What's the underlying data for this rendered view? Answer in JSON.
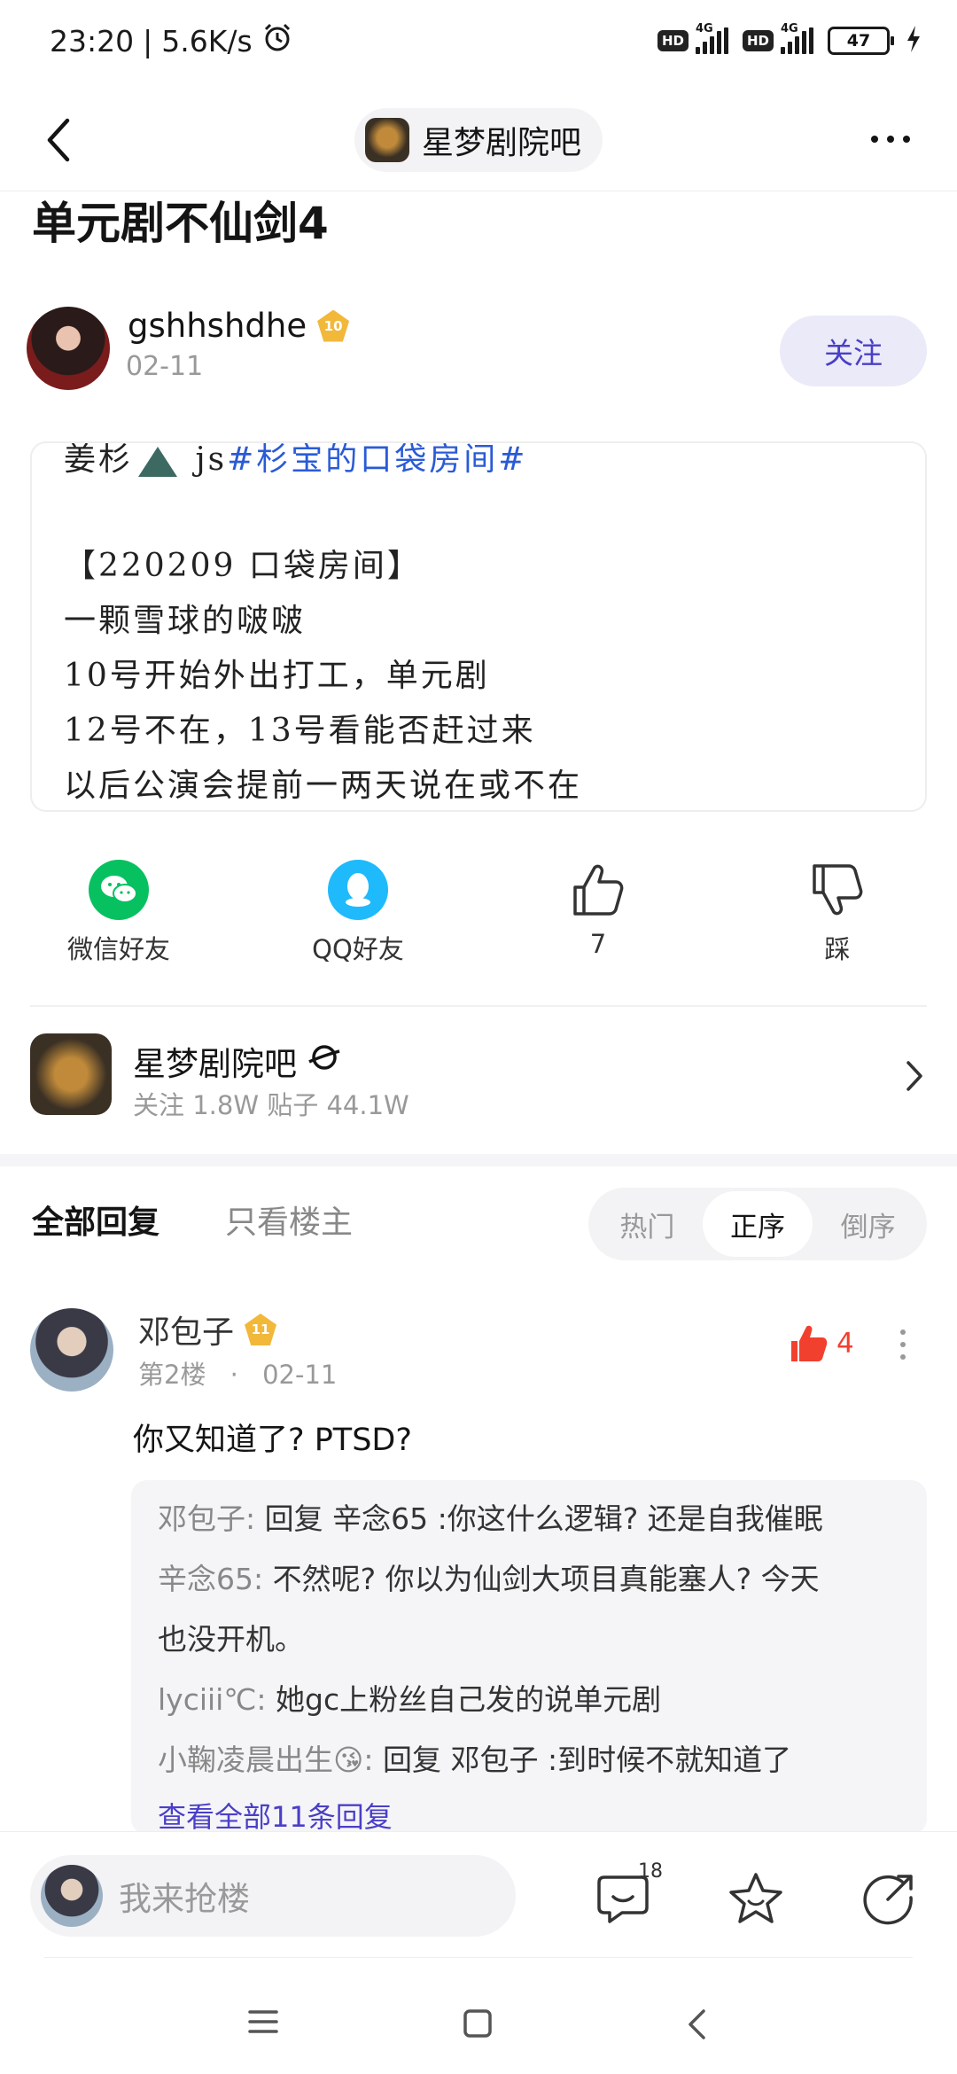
{
  "status_bar": {
    "time": "23:20",
    "separator": "|",
    "net_speed": "5.6K/s",
    "hd1": "HD",
    "net1": "4G",
    "hd2": "HD",
    "net2": "4G",
    "battery": "47"
  },
  "nav": {
    "forum_name": "星梦剧院吧"
  },
  "post": {
    "title": "单元剧不仙剑4",
    "author": "gshhshdhe",
    "author_level": "10",
    "date": "02-11",
    "follow_label": "关注",
    "image_lines": {
      "l1_a": "姜杉",
      "l1_b": "js",
      "l1_tag": "#杉宝的口袋房间#",
      "l2": "【220209 口袋房间】",
      "l3": "一颗雪球的啵啵",
      "l4": "10号开始外出打工，单元剧",
      "l5": "12号不在，13号看能否赶过来",
      "l6": "以后公演会提前一两天说在或不在"
    }
  },
  "actions": {
    "wechat": "微信好友",
    "qq": "QQ好友",
    "like_count": "7",
    "dislike": "踩"
  },
  "forum_card": {
    "name": "星梦剧院吧",
    "meta": "关注 1.8W   贴子 44.1W"
  },
  "replies_header": {
    "tab_all": "全部回复",
    "tab_owner": "只看楼主",
    "sort_hot": "热门",
    "sort_asc": "正序",
    "sort_desc": "倒序"
  },
  "reply": {
    "author": "邓包子",
    "level": "11",
    "floor": "第2楼",
    "dot": "·",
    "date": "02-11",
    "like_count": "4",
    "text": "你又知道了? PTSD?",
    "sub_replies": [
      {
        "user": "邓包子:",
        "text": " 回复 辛念65 :你这什么逻辑? 还是自我催眠"
      },
      {
        "user": "辛念65:",
        "text": " 不然呢? 你以为仙剑大项目真能塞人? 今天"
      },
      {
        "user": "",
        "text": "也没开机。"
      },
      {
        "user": "lyciii℃:",
        "text": " 她gc上粉丝自己发的说单元剧"
      },
      {
        "user": "小鞠凌晨出生😘:",
        "text": " 回复  邓包子 :到时候不就知道了"
      }
    ],
    "view_all": "查看全部11条回复"
  },
  "bottom_bar": {
    "input_placeholder": "我来抢楼",
    "comment_count": "18"
  },
  "colors": {
    "accent": "#4a3fc8",
    "like_red": "#f2402e",
    "wechat_green": "#07c160",
    "qq_blue": "#1ebafc"
  }
}
